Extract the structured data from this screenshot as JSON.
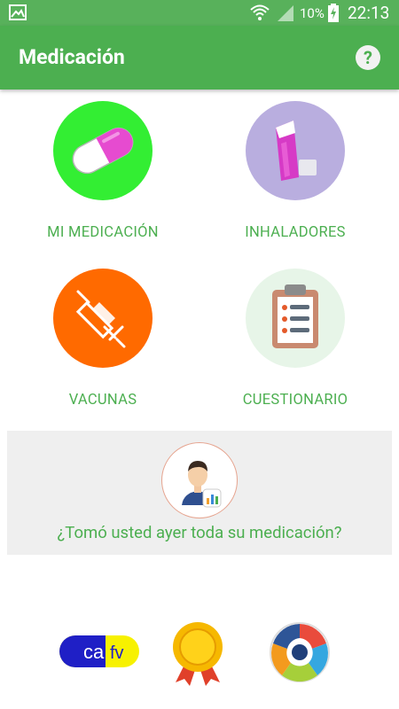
{
  "status_bar": {
    "battery_percent": "10%",
    "time": "22:13"
  },
  "app_bar": {
    "title": "Medicación",
    "help_symbol": "?"
  },
  "tiles": [
    {
      "label": "MI MEDICACIÓN",
      "icon": "pill-icon",
      "color": "#33ee33"
    },
    {
      "label": "INHALADORES",
      "icon": "inhaler-icon",
      "color": "#b9aedf"
    },
    {
      "label": "VACUNAS",
      "icon": "syringe-icon",
      "color": "#ff6a00"
    },
    {
      "label": "CUESTIONARIO",
      "icon": "clipboard-icon",
      "color": "#e7f5e8"
    }
  ],
  "question_panel": {
    "question": "¿Tomó usted ayer toda su medicación?"
  },
  "logos": {
    "cafv_left": "ca",
    "cafv_right": "fv"
  },
  "colors": {
    "primary": "#4caf50",
    "status_bar": "#58b15b"
  }
}
